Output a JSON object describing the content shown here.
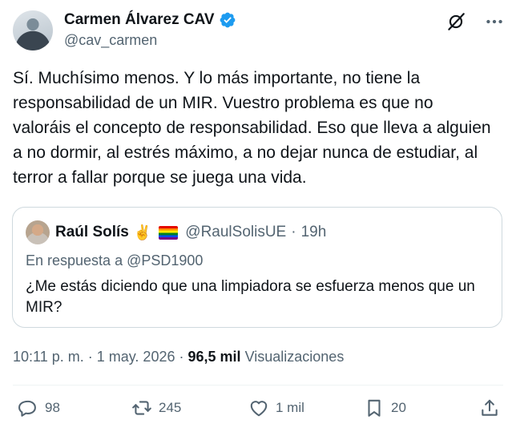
{
  "author": {
    "display_name": "Carmen Álvarez CAV",
    "handle": "@cav_carmen",
    "verified": true
  },
  "tweet": {
    "text": "Sí. Muchísimo menos. Y lo más importante, no tiene la responsabilidad de un MIR. Vuestro problema es que no valoráis el concepto de responsabilidad. Eso que lleva a alguien a no dormir, al estrés máximo, a no dejar nunca de estudiar, al terror a fallar porque se juega una vida."
  },
  "quote": {
    "display_name": "Raúl Solís",
    "emojis": "✌️",
    "handle": "@RaulSolisUE",
    "separator": "·",
    "time": "19h",
    "reply_to": "En respuesta a @PSD1900",
    "text": "¿Me estás diciendo que una limpiadora se esfuerza menos que un MIR?"
  },
  "meta": {
    "time": "10:11 p. m.",
    "sep1": "·",
    "date": "1 may. 2026",
    "sep2": "·",
    "views_count": "96,5 mil",
    "views_label": "Visualizaciones"
  },
  "actions": {
    "replies": "98",
    "reposts": "245",
    "likes": "1 mil",
    "bookmarks": "20"
  },
  "icons": {
    "top_left": "grok-icon",
    "top_right": "more-icon",
    "actions": [
      "reply-icon",
      "repost-icon",
      "like-icon",
      "bookmark-icon",
      "share-icon"
    ]
  },
  "colors": {
    "verified": "#1d9bf0",
    "secondary_text": "#536471",
    "primary_text": "#0f1419",
    "border": "#cfd9de"
  }
}
